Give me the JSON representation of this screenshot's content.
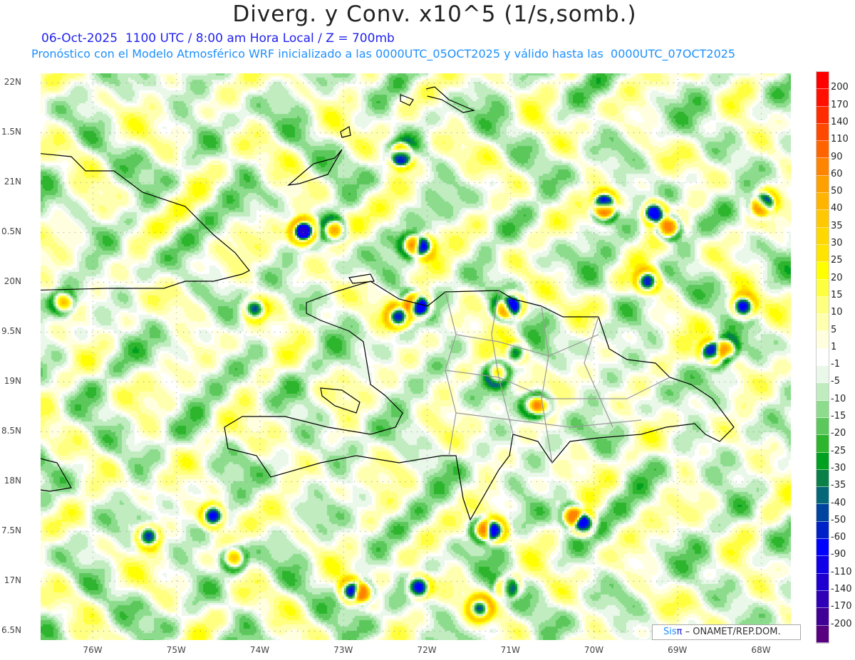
{
  "header": {
    "title": "Diverg. y Conv. x10^5 (1/s,somb.)",
    "line1": "06-Oct-2025  1100 UTC / 8:00 am Hora Local / Z = 700mb",
    "line2": "Pronóstico con el Modelo Atmosférico WRF inicializado a las 0000UTC_05OCT2025 y válido hasta las  0000UTC_07OCT2025"
  },
  "axes": {
    "lat_labels": [
      "22N",
      "1.5N",
      "21N",
      "0.5N",
      "20N",
      "9.5N",
      "19N",
      "8.5N",
      "18N",
      "7.5N",
      "17N",
      "6.5N"
    ],
    "lon_labels": [
      "76W",
      "75W",
      "74W",
      "73W",
      "72W",
      "71W",
      "70W",
      "69W",
      "68W"
    ]
  },
  "colorbar": {
    "labels": [
      "200",
      "170",
      "140",
      "110",
      "90",
      "60",
      "50",
      "40",
      "35",
      "30",
      "25",
      "20",
      "15",
      "10",
      "5",
      "1",
      "-1",
      "-5",
      "-10",
      "-15",
      "-20",
      "-25",
      "-30",
      "-35",
      "-40",
      "-50",
      "-60",
      "-90",
      "-110",
      "-140",
      "-170",
      "-200"
    ],
    "colors": [
      "#ff0000",
      "#ff1000",
      "#ff2c00",
      "#ff4800",
      "#ff6400",
      "#ff8400",
      "#ffa000",
      "#ffb400",
      "#ffc800",
      "#ffd800",
      "#ffe400",
      "#ffff00",
      "#ffff40",
      "#ffff80",
      "#ffffb0",
      "#ffffe0",
      "#ffffff",
      "#eaf8ea",
      "#c0ecc0",
      "#8ddc8d",
      "#5cc85c",
      "#2db52d",
      "#00a020",
      "#088048",
      "#046878",
      "#0044a0",
      "#0020c8",
      "#0000ff",
      "#1000e8",
      "#2000d0",
      "#3000b8",
      "#400098",
      "#580080"
    ]
  },
  "credit": {
    "sis": "Sis",
    "pi": "π",
    "rest": " – ONAMET/REP.DOM."
  }
}
